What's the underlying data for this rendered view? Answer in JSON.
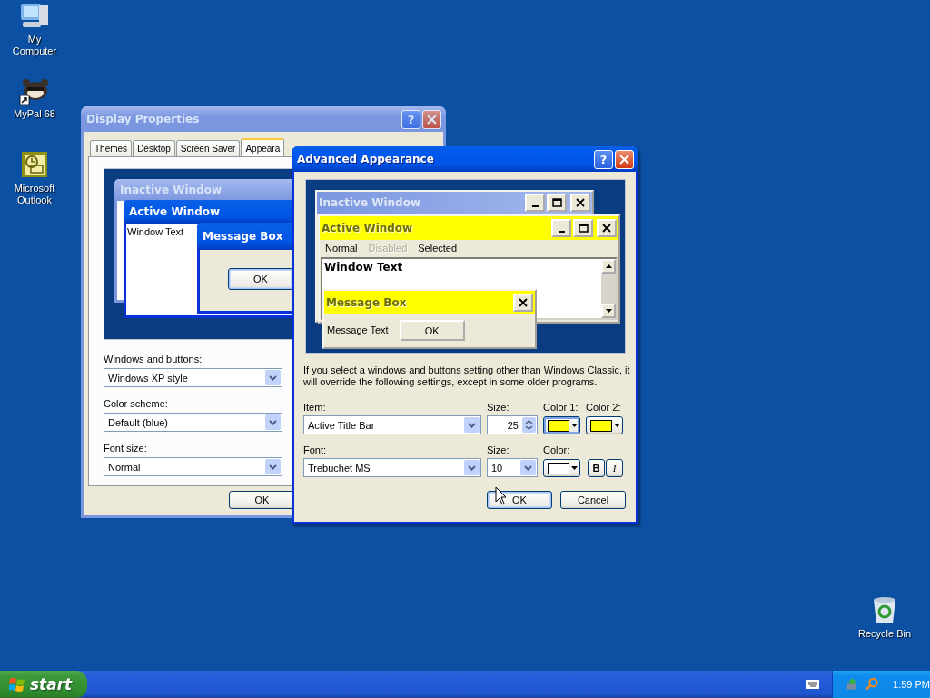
{
  "desktop_icons": [
    {
      "label": "My Computer",
      "kind": "computer",
      "shortcut": false
    },
    {
      "label": "MyPal 68",
      "kind": "raccoon",
      "shortcut": true
    },
    {
      "label": "Microsoft Outlook",
      "kind": "outlook",
      "shortcut": false
    }
  ],
  "recycle_bin": {
    "label": "Recycle Bin"
  },
  "display_properties": {
    "title": "Display Properties",
    "active": false,
    "help": "?",
    "tabs": [
      {
        "label": "Themes",
        "selected": false
      },
      {
        "label": "Desktop",
        "selected": false
      },
      {
        "label": "Screen Saver",
        "selected": false
      },
      {
        "label": "Appeara",
        "selected": true
      }
    ],
    "preview": {
      "inactive_title": "Inactive Window",
      "active_title": "Active Window",
      "window_text": "Window Text",
      "message_title": "Message Box",
      "ok": "OK"
    },
    "fields": [
      {
        "label": "Windows and buttons:",
        "value": "Windows XP style"
      },
      {
        "label": "Color scheme:",
        "value": "Default (blue)"
      },
      {
        "label": "Font size:",
        "value": "Normal"
      }
    ],
    "buttons": [
      "OK"
    ]
  },
  "advanced_appearance": {
    "title": "Advanced Appearance",
    "active": true,
    "help": "?",
    "preview": {
      "inactive_title": "Inactive Window",
      "active_title": "Active Window",
      "menu": [
        {
          "label": "Normal",
          "disabled": false
        },
        {
          "label": "Disabled",
          "disabled": true
        },
        {
          "label": "Selected",
          "disabled": false
        }
      ],
      "window_text": "Window Text",
      "message_title": "Message Box",
      "message_text": "Message Text",
      "ok": "OK"
    },
    "note": "If you select a windows and buttons setting other than Windows Classic, it will override the following settings, except in some older programs.",
    "item": {
      "label": "Item:",
      "value": "Active Title Bar"
    },
    "item_size": {
      "label": "Size:",
      "value": "25"
    },
    "color1": {
      "label": "Color 1:",
      "color": "#ffff00",
      "focused": true
    },
    "color2": {
      "label": "Color 2:",
      "color": "#ffff00",
      "focused": false
    },
    "font": {
      "label": "Font:",
      "value": "Trebuchet MS"
    },
    "font_size": {
      "label": "Size:",
      "value": "10"
    },
    "font_color": {
      "label": "Color:",
      "color": "#ffffff",
      "focused": false
    },
    "bold": "B",
    "italic": "I",
    "buttons": [
      {
        "label": "OK",
        "default": true
      },
      {
        "label": "Cancel",
        "default": false
      }
    ]
  },
  "taskbar": {
    "start": "start",
    "clock": "1:59 PM"
  }
}
